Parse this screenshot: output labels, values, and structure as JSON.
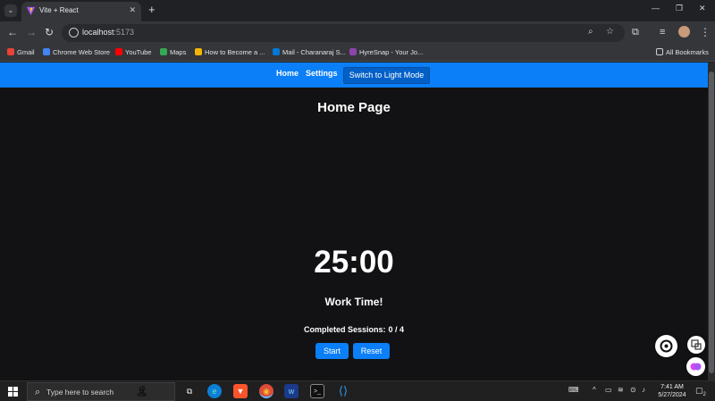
{
  "browser": {
    "tab_title": "Vite + React",
    "tab_close": "✕",
    "new_tab": "+",
    "url_host": "localhost",
    "url_port": ":5173",
    "window_controls": [
      "—",
      "❐",
      "✕"
    ],
    "bookmarks": [
      {
        "label": "Gmail",
        "color": "#ea4335"
      },
      {
        "label": "Chrome Web Store",
        "color": "#4285f4"
      },
      {
        "label": "YouTube",
        "color": "#ff0000"
      },
      {
        "label": "Maps",
        "color": "#34a853"
      },
      {
        "label": "How to Become a ...",
        "color": "#f4b400"
      },
      {
        "label": "Mail - Charanaraj S...",
        "color": "#0078d4"
      },
      {
        "label": "HyreSnap - Your Jo...",
        "color": "#8e44ad"
      }
    ],
    "all_bookmarks": "All Bookmarks"
  },
  "app": {
    "nav": {
      "home": "Home",
      "settings": "Settings",
      "theme_button": "Switch to Light Mode"
    },
    "page_title": "Home Page",
    "timer": "25:00",
    "mode_label": "Work Time!",
    "sessions_label": "Completed Sessions:",
    "sessions_value": "0 / 4",
    "start_button": "Start",
    "reset_button": "Reset"
  },
  "taskbar": {
    "search_placeholder": "Type here to search",
    "time": "7:41 AM",
    "date": "5/27/2024",
    "notification_count": "2"
  },
  "colors": {
    "accent": "#0b7ff7",
    "background": "#121214"
  }
}
